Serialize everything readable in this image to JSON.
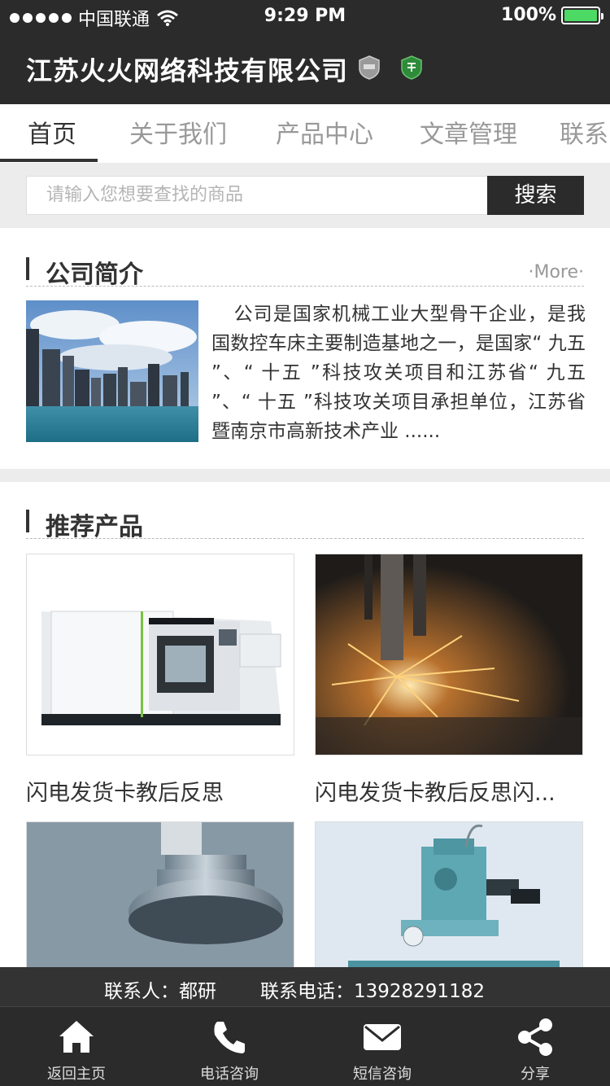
{
  "status_bar": {
    "carrier": "中国联通",
    "time": "9:29 PM",
    "battery": "100%",
    "battery_level": 1.0
  },
  "header": {
    "title": "江苏火火网络科技有限公司"
  },
  "tabs": [
    {
      "label": "首页",
      "active": true
    },
    {
      "label": "关于我们"
    },
    {
      "label": "产品中心"
    },
    {
      "label": "文章管理"
    },
    {
      "label": "联系"
    }
  ],
  "search": {
    "placeholder": "请输入您想要查找的商品",
    "button": "搜索"
  },
  "intro": {
    "title": "公司简介",
    "more": "·More·",
    "text": "公司是国家机械工业大型骨干企业，是我国数控车床主要制造基地之一，是国家“ 九五 ”、“ 十五 ”科技攻关项目和江苏省“ 九五 ”、“ 十五 ”科技攻关项目承担单位，江苏省暨南京市高新技术产业 ......"
  },
  "products": {
    "title": "推荐产品",
    "items": [
      {
        "name": "闪电发货卡教后反思"
      },
      {
        "name": "闪电发货卡教后反思闪..."
      },
      {
        "name": ""
      },
      {
        "name": ""
      }
    ]
  },
  "contact": {
    "person": "联系人：都研",
    "phone": "联系电话：13928291182"
  },
  "bottom_nav": [
    {
      "label": "返回主页",
      "icon": "home-icon"
    },
    {
      "label": "电话咨询",
      "icon": "phone-icon"
    },
    {
      "label": "短信咨询",
      "icon": "mail-icon"
    },
    {
      "label": "分享",
      "icon": "share-icon"
    }
  ],
  "colors": {
    "dark": "#2b2b2b",
    "battery_green": "#4cd964"
  }
}
